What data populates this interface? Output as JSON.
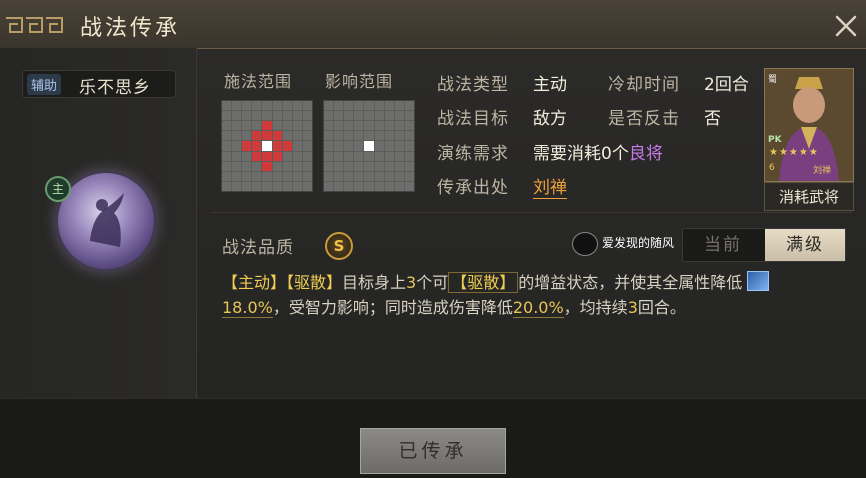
{
  "window": {
    "title": "战法传承"
  },
  "skill": {
    "category_badge": "辅助",
    "name": "乐不思乡",
    "orb_badge": "主"
  },
  "ranges": {
    "cast_label": "施法范围",
    "effect_label": "影响范围"
  },
  "info": {
    "type_label": "战法类型",
    "type_value": "主动",
    "cooldown_label": "冷却时间",
    "cooldown_value": "2回合",
    "target_label": "战法目标",
    "target_value": "敌方",
    "counter_label": "是否反击",
    "counter_value": "否",
    "training_label": "演练需求",
    "training_prefix": "需要消耗0个",
    "training_hero_grade": "良将",
    "source_label": "传承出处",
    "source_value": "刘禅"
  },
  "portrait": {
    "tag": "蜀",
    "caption": "消耗武将",
    "pk": "PK",
    "stars": "★★★★★",
    "cost": "6",
    "name": "刘禅"
  },
  "quality": {
    "label": "战法品质",
    "grade": "S"
  },
  "watermark": {
    "text": "爱发现的随风"
  },
  "toggle": {
    "current": "当前",
    "max": "满级"
  },
  "description": {
    "p1": "【主动】",
    "p2": "【驱散】",
    "p3": "目标身上",
    "p4": "3",
    "p5": "个可",
    "p6": "【驱散】",
    "p7": "的增益状态，并使其全属性降低",
    "p8": "18.0%",
    "p9": "，受智力影响；同时造成伤害降低",
    "p10": "20.0%",
    "p11": "，均持续",
    "p12": "3",
    "p13": "回合。"
  },
  "actions": {
    "inherited": "已传承"
  },
  "colors": {
    "accent_gold": "#efcd52",
    "purple": "#c77bea",
    "orange": "#f0a23a",
    "red_cell": "#cf3a3a"
  },
  "icons": [
    "close-icon",
    "title-ornament-icon",
    "skill-orb-icon",
    "buff-icon",
    "watermark-logo-icon"
  ]
}
